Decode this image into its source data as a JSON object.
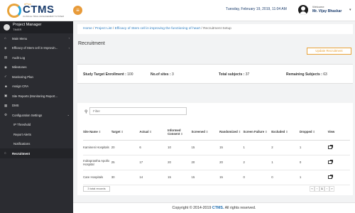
{
  "app": {
    "logo_text": "CTMS",
    "logo_sup": "ePlus",
    "logo_sub": "CLINICAL TRIAL MANAGEMENT SYSTEM"
  },
  "header": {
    "datetime": "Tuesday, February 19, 2019, 11:04 AM",
    "welcome": "Welcome",
    "user": "Mr. Vijay Bhaskar"
  },
  "sidebar": {
    "title": "Project Manager",
    "subtitle": "TIMER",
    "items": [
      {
        "label": "Main Menu",
        "icon": "home-icon",
        "chevron": "‹"
      },
      {
        "label": "Efficacy of Stem cell in Improvin...",
        "icon": "project-icon",
        "chevron": "‹"
      },
      {
        "label": "Audit Log",
        "icon": "audit-icon"
      },
      {
        "label": "Milestones",
        "icon": "milestone-icon"
      },
      {
        "label": "Monitoring Plan",
        "icon": "monitoring-icon"
      },
      {
        "label": "Assign CRA",
        "icon": "assign-icon"
      },
      {
        "label": "Site Reports (Monitoring Report...",
        "icon": "report-icon"
      },
      {
        "label": "DMS",
        "icon": "dms-icon"
      },
      {
        "label": "Configuration Settings",
        "icon": "settings-icon",
        "chevron": "⌄"
      },
      {
        "label": "IP Threshold",
        "sub": true
      },
      {
        "label": "Report Alerts",
        "sub": true
      },
      {
        "label": "Notifications",
        "sub": true
      },
      {
        "label": "Recruitment",
        "icon": "circle-icon",
        "active": true
      }
    ]
  },
  "breadcrumb": {
    "home": "Home",
    "sep": "/",
    "project_list": "Project List",
    "study": "Efficacy of Stem cell in improving the functioning of heart",
    "current": "Recruitment Setup"
  },
  "page": {
    "title": "Recruitment",
    "update_button": "Update Recruitment"
  },
  "summary": {
    "enrollment_label": "Study Target Enrollment :",
    "enrollment_value": "100",
    "sites_label": "No.of sites :",
    "sites_value": "3",
    "total_label": "Total subjects :",
    "total_value": "37",
    "remaining_label": "Remaining Subjects :",
    "remaining_value": "63"
  },
  "search": {
    "placeholder": "Filter"
  },
  "table": {
    "headers": [
      "Site Name",
      "Target",
      "Actual",
      "Informed Consent",
      "Screened",
      "Randomized",
      "Screen Failure",
      "Excluded",
      "Dropped",
      "View"
    ],
    "rows": [
      [
        "Kamineni Hospitals",
        "20",
        "6",
        "10",
        "15",
        "15",
        "1",
        "2",
        "1"
      ],
      [
        "Indraprastha Apollo Hospital",
        "25",
        "17",
        "20",
        "20",
        "20",
        "2",
        "1",
        "0"
      ],
      [
        "Care Hospitals",
        "30",
        "14",
        "15",
        "15",
        "15",
        "0",
        "0",
        "1"
      ]
    ],
    "total_records": "3 total records"
  },
  "pager": {
    "first": "«",
    "prev": "‹",
    "current": "1",
    "next": "›",
    "last": "»"
  },
  "footer": {
    "prefix": "Copyright © 2014-2019",
    "brand": "CTMS.",
    "suffix": "All rights reserved."
  },
  "colors": {
    "accent": "#e8a33a",
    "sidebar": "#2b2c31",
    "brand_blue": "#1b3d6d"
  }
}
